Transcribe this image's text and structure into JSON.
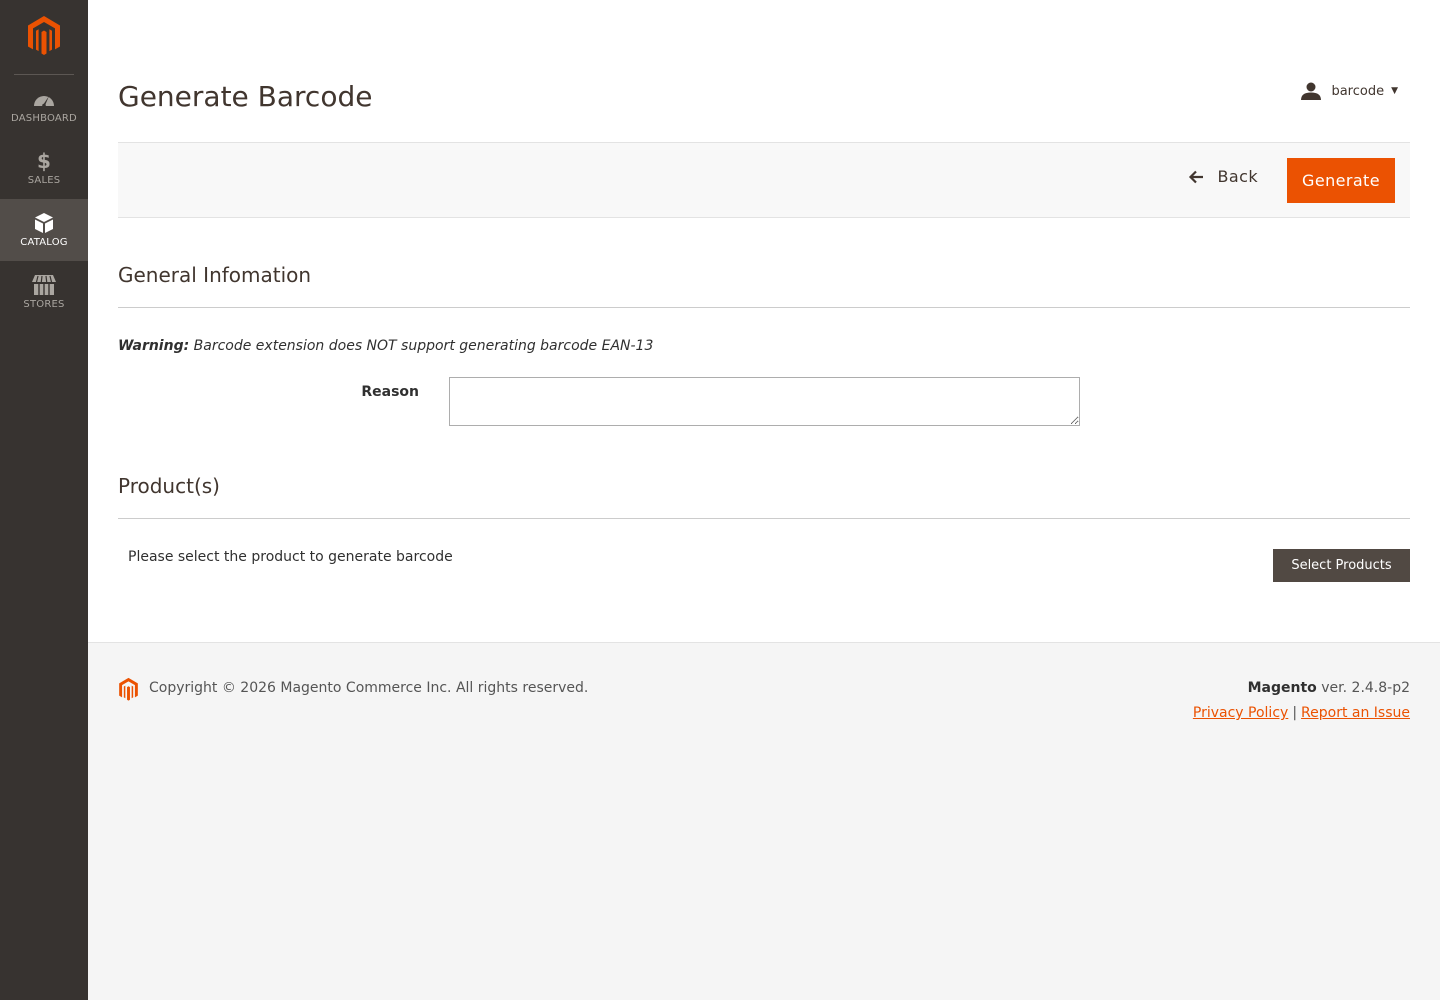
{
  "colors": {
    "accent": "#eb5202",
    "sidebar": "#373330",
    "sidebar_active": "#524d49",
    "secondary_button": "#514943"
  },
  "sidebar": {
    "logo_icon": "magento-logo-icon",
    "items": [
      {
        "label": "DASHBOARD",
        "icon": "dashboard-gauge-icon",
        "active": false
      },
      {
        "label": "SALES",
        "icon": "dollar-icon",
        "active": false
      },
      {
        "label": "CATALOG",
        "icon": "box-icon",
        "active": true
      },
      {
        "label": "STORES",
        "icon": "store-icon",
        "active": false
      }
    ]
  },
  "header": {
    "title": "Generate Barcode",
    "user": {
      "name": "barcode",
      "icon": "user-icon"
    }
  },
  "actions": {
    "back_label": "Back",
    "generate_label": "Generate"
  },
  "general": {
    "title": "General Infomation",
    "warning_label": "Warning:",
    "warning_text": " Barcode extension does NOT support generating barcode EAN-13",
    "reason_label": "Reason",
    "reason_value": ""
  },
  "products": {
    "title": "Product(s)",
    "hint": "Please select the product to generate barcode",
    "select_label": "Select Products"
  },
  "footer": {
    "copyright": "Copyright © 2026 Magento Commerce Inc. All rights reserved.",
    "brand": "Magento",
    "version": " ver. 2.4.8-p2",
    "privacy_label": "Privacy Policy",
    "separator": "|",
    "report_label": "Report an Issue"
  }
}
